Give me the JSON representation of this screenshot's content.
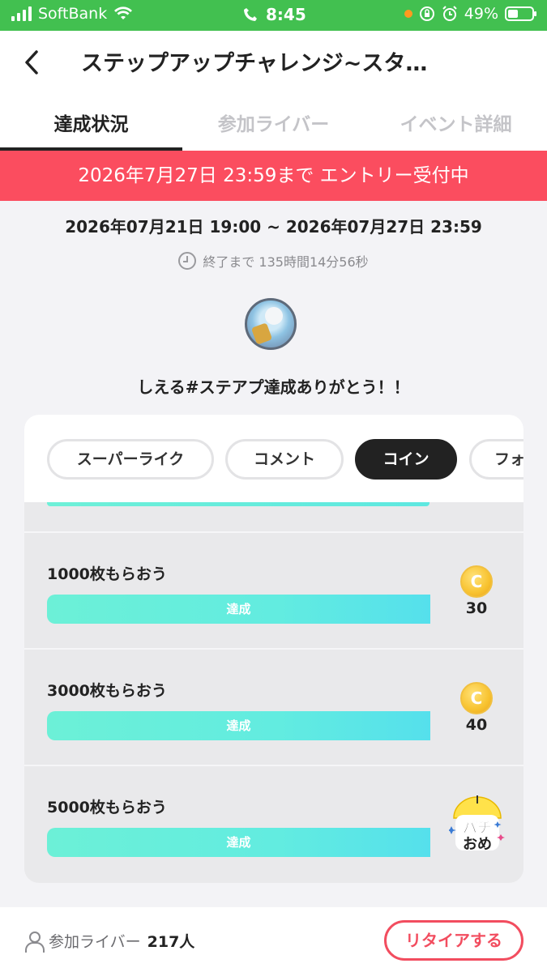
{
  "status_bar": {
    "carrier": "SoftBank",
    "time": "8:45",
    "battery": "49%"
  },
  "header": {
    "title": "ステップアップチャレンジ~スタ…"
  },
  "tabs": [
    {
      "label": "達成状況",
      "active": true
    },
    {
      "label": "参加ライバー",
      "active": false
    },
    {
      "label": "イベント詳細",
      "active": false
    }
  ],
  "entry_banner": "2026年7月27日 23:59まで エントリー受付中",
  "period": "2026年07月21日 19:00 ~ 2026年07月27日 23:59",
  "countdown": "終了まで 135時間14分56秒",
  "message": "しえる#ステアプ達成ありがとう！！",
  "filters": [
    {
      "label": "スーパーライク",
      "active": false
    },
    {
      "label": "コメント",
      "active": false
    },
    {
      "label": "コイン",
      "active": true
    },
    {
      "label": "フォ",
      "active": false
    }
  ],
  "goals": [
    {
      "title": "1000枚もらおう",
      "status": "達成",
      "reward_type": "coin",
      "reward_value": "30",
      "progress": 1.0
    },
    {
      "title": "3000枚もらおう",
      "status": "達成",
      "reward_type": "coin",
      "reward_value": "40",
      "progress": 1.0
    },
    {
      "title": "5000枚もらおう",
      "status": "達成",
      "reward_type": "sticker",
      "sticker_text": "パチおめ",
      "progress": 1.0
    }
  ],
  "coin_symbol": "C",
  "footer": {
    "participants_label": "参加ライバー",
    "participants_count": "217人",
    "retire_label": "リタイアする"
  },
  "colors": {
    "status_green": "#42c050",
    "banner_red": "#fb4d5f",
    "progress_teal": "#62ece0",
    "retire_red": "#f24d5f"
  }
}
